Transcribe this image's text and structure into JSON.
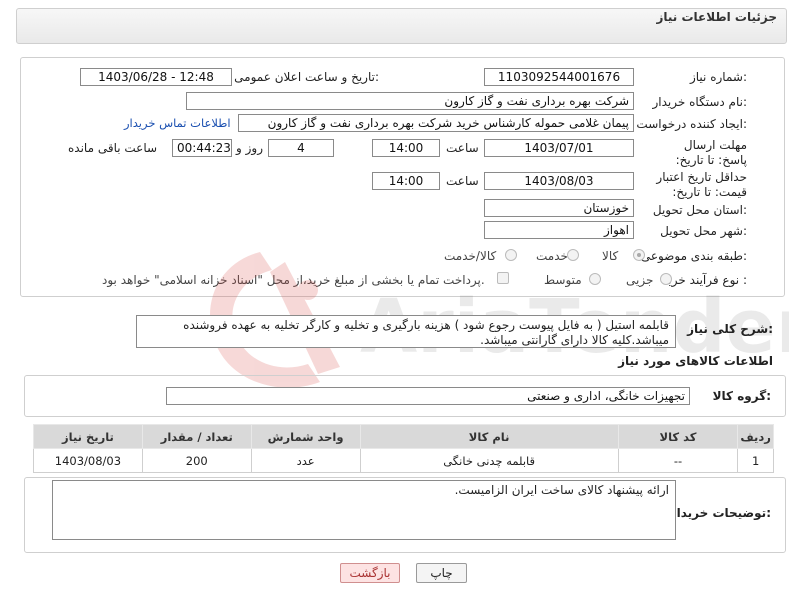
{
  "header": {
    "title": "جزئیات اطلاعات نیاز"
  },
  "form": {
    "need_number_label": "شماره نیاز:",
    "need_number": "1103092544001676",
    "announce_label": "تاریخ و ساعت اعلان عمومی:",
    "announce_value": "1403/06/28 - 12:48",
    "buyer_org_label": "نام دستگاه خریدار:",
    "buyer_org": "شرکت بهره برداری نفت و گاز کارون",
    "creator_label": "ایجاد کننده درخواست:",
    "creator": "پیمان غلامی حموله کارشناس خرید شرکت بهره برداری نفت و گاز کارون",
    "contact_link": "اطلاعات تماس خریدار",
    "deadline_label": "مهلت ارسال پاسخ: تا تاریخ:",
    "deadline_date": "1403/07/01",
    "time_word": "ساعت",
    "deadline_time": "14:00",
    "days_value": "4",
    "days_word": "روز و",
    "remaining_time": "00:44:23",
    "remaining_word": "ساعت باقی مانده",
    "validity_label": "حداقل تاریخ اعتبار قیمت: تا تاریخ:",
    "validity_date": "1403/08/03",
    "validity_time": "14:00",
    "province_label": "استان محل تحویل:",
    "province": "خوزستان",
    "city_label": "شهر محل تحویل:",
    "city": "اهواز",
    "category_label": "طبقه بندی موضوعی:",
    "category_options": [
      "کالا",
      "خدمت",
      "کالا/خدمت"
    ],
    "process_label": "نوع فرآیند خرید :",
    "process_options": [
      "جزیی",
      "متوسط"
    ],
    "process_note": "پرداخت تمام یا بخشی از مبلغ خرید،از محل \"اسناد خزانه اسلامی\" خواهد بود."
  },
  "description": {
    "label": "شرح کلی نیاز:",
    "text": "قابلمه استیل ( به فایل پیوست رجوع شود ) هزینه بارگیری و تخلیه و کارگر تخلیه به عهده فروشنده میباشد.کلیه کالا دارای گارانتی میباشد."
  },
  "goods": {
    "section_title": "اطلاعات کالاهای مورد نیاز",
    "group_label": "گروه کالا:",
    "group_value": "تجهیزات خانگی، اداری و صنعتی",
    "columns": [
      "ردیف",
      "کد کالا",
      "نام کالا",
      "واحد شمارش",
      "تعداد / مقدار",
      "تاریخ نیاز"
    ],
    "rows": [
      [
        "1",
        "--",
        "قابلمه چدنی خانگی",
        "عدد",
        "200",
        "1403/08/03"
      ]
    ]
  },
  "buyer_notes": {
    "label": "توضیحات خریدار:",
    "text": "ارائه پیشنهاد کالای ساخت ایران الزامیست."
  },
  "buttons": {
    "print": "چاپ",
    "back": "بازگشت"
  },
  "watermark_text": "AriaTender.neT"
}
